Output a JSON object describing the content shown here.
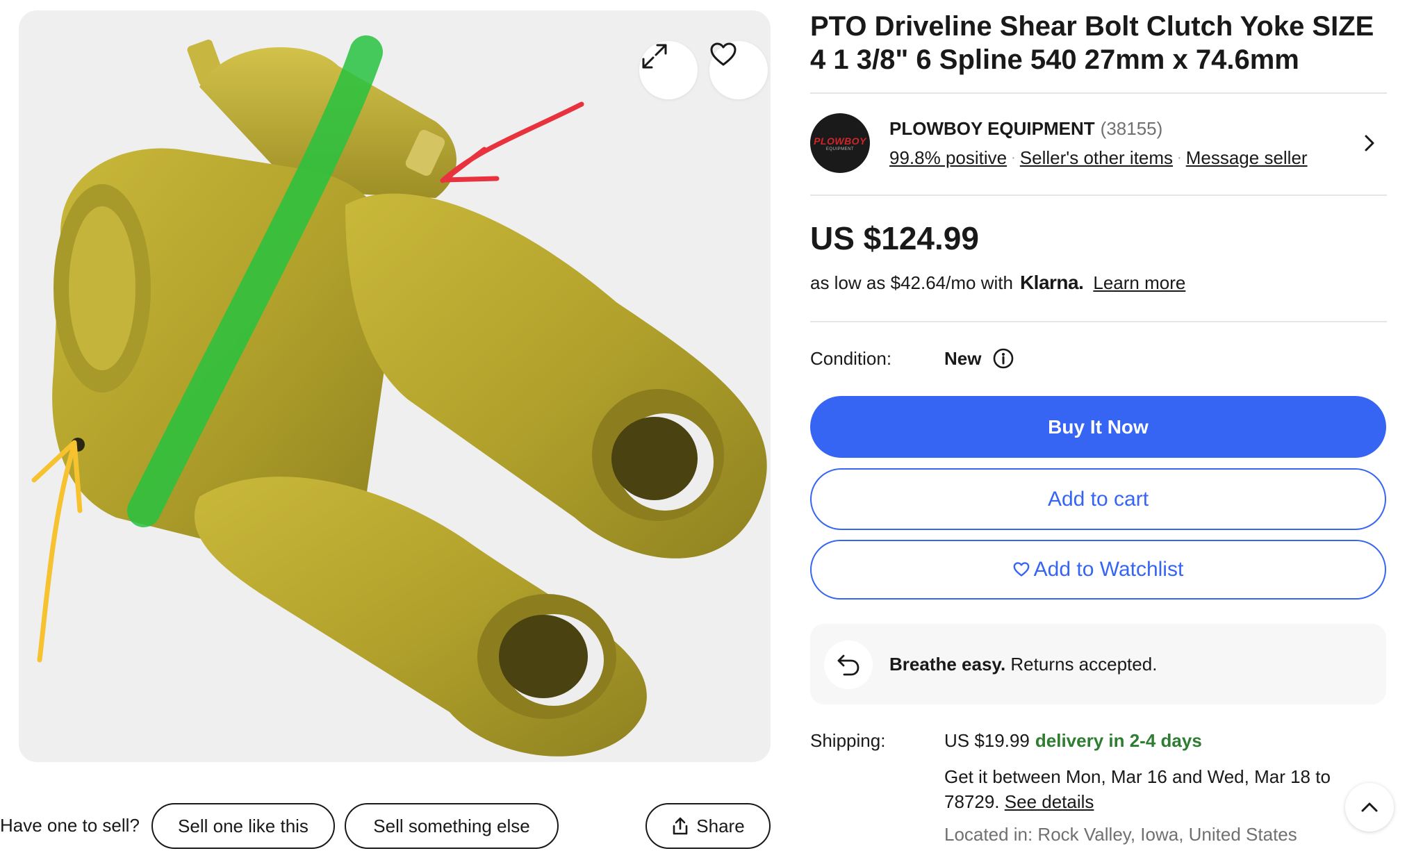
{
  "listing": {
    "title": "PTO Driveline Shear Bolt Clutch Yoke SIZE 4 1 3/8\" 6 Spline 540 27mm x 74.6mm"
  },
  "gallery": {
    "expand_icon": "expand-icon",
    "watch_icon": "heart-icon"
  },
  "seller": {
    "logo_text": "PLOWBOY",
    "logo_subtext": "EQUIPMENT",
    "name": "PLOWBOY EQUIPMENT",
    "count": "(38155)",
    "feedback": "99.8% positive",
    "other_items": "Seller's other items",
    "message": "Message seller"
  },
  "pricing": {
    "price": "US $124.99",
    "installment": "as low as $42.64/mo with",
    "klarna": "Klarna.",
    "learn_more": "Learn more"
  },
  "condition": {
    "label": "Condition:",
    "value": "New"
  },
  "actions": {
    "buy_now": "Buy It Now",
    "add_to_cart": "Add to cart",
    "add_to_watchlist": "Add to Watchlist"
  },
  "returns": {
    "bold": "Breathe easy.",
    "text": "Returns accepted."
  },
  "shipping": {
    "label": "Shipping:",
    "price": "US $19.99",
    "delivery": "delivery in 2-4 days",
    "eta": "Get it between Mon, Mar 16 and Wed, Mar 18 to 78729.",
    "see_details": "See details",
    "location": "Located in: Rock Valley, Iowa, United States"
  },
  "sell_row": {
    "question": "Have one to sell?",
    "sell_one": "Sell one like this",
    "sell_else": "Sell something else",
    "share": "Share"
  },
  "colors": {
    "accent": "#3665f3",
    "delivery_green": "#2e7d32",
    "part_yellow": "#b5a532"
  }
}
